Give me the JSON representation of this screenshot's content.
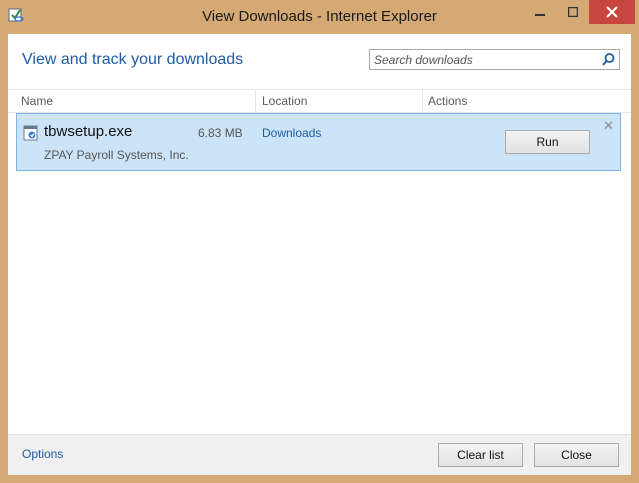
{
  "window": {
    "title": "View Downloads - Internet Explorer",
    "frame_color": "#d4a974",
    "close_color": "#c7463f"
  },
  "header": {
    "title": "View and track your downloads",
    "search_placeholder": "Search downloads"
  },
  "columns": {
    "name": "Name",
    "location": "Location",
    "actions": "Actions"
  },
  "downloads": [
    {
      "file_name": "tbwsetup.exe",
      "size": "6.83 MB",
      "publisher": "ZPAY Payroll Systems, Inc.",
      "location": "Downloads",
      "action_label": "Run",
      "remove_glyph": "✕"
    }
  ],
  "footer": {
    "options_label": "Options",
    "clear_label": "Clear list",
    "close_label": "Close"
  },
  "icons": {
    "title": "ie-download-icon",
    "search": "search-icon",
    "file": "exe-file-icon"
  }
}
